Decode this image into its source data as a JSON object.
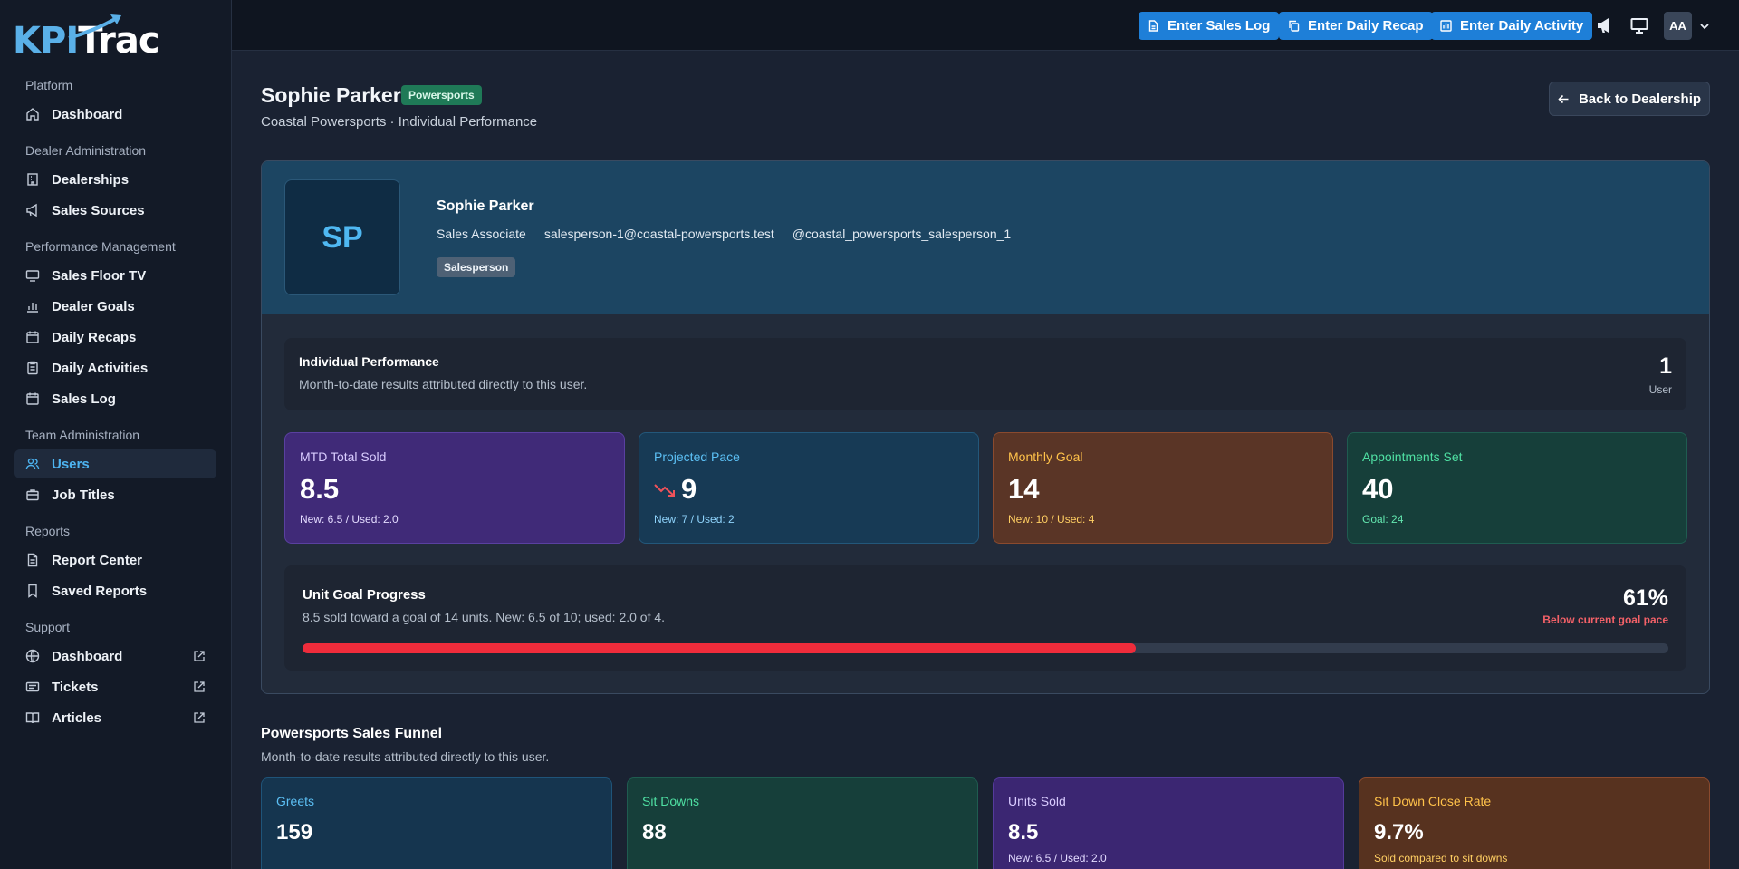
{
  "app": {
    "logo_text_a": "KPI",
    "logo_text_b": "Trac",
    "brand_color": "#1e7fd8"
  },
  "sidebar": {
    "sections": [
      {
        "title": "Platform",
        "items": [
          {
            "label": "Dashboard",
            "icon": "home-icon"
          }
        ]
      },
      {
        "title": "Dealer Administration",
        "items": [
          {
            "label": "Dealerships",
            "icon": "building-icon"
          },
          {
            "label": "Sales Sources",
            "icon": "megaphone-icon"
          }
        ]
      },
      {
        "title": "Performance Management",
        "items": [
          {
            "label": "Sales Floor TV",
            "icon": "monitor-icon"
          },
          {
            "label": "Dealer Goals",
            "icon": "bar-chart-icon"
          },
          {
            "label": "Daily Recaps",
            "icon": "calendar-icon"
          },
          {
            "label": "Daily Activities",
            "icon": "clipboard-icon"
          },
          {
            "label": "Sales Log",
            "icon": "calendar-icon"
          }
        ]
      },
      {
        "title": "Team Administration",
        "items": [
          {
            "label": "Users",
            "icon": "users-icon",
            "active": true
          },
          {
            "label": "Job Titles",
            "icon": "briefcase-icon"
          }
        ]
      },
      {
        "title": "Reports",
        "items": [
          {
            "label": "Report Center",
            "icon": "document-icon"
          },
          {
            "label": "Saved Reports",
            "icon": "bookmark-icon"
          }
        ]
      },
      {
        "title": "Support",
        "items": [
          {
            "label": "Dashboard",
            "icon": "globe-icon",
            "external": true
          },
          {
            "label": "Tickets",
            "icon": "ticket-icon",
            "external": true
          },
          {
            "label": "Articles",
            "icon": "book-icon",
            "external": true
          }
        ]
      }
    ]
  },
  "topbar": {
    "enter_sales_log": "Enter Sales Log",
    "enter_daily_recap": "Enter Daily Recap",
    "enter_daily_activity": "Enter Daily Activity",
    "avatar_initials": "AA"
  },
  "header": {
    "title": "Sophie Parker",
    "badge": "Powersports",
    "subtitle": "Coastal Powersports · Individual Performance",
    "back_button": "Back to Dealership"
  },
  "profile": {
    "initials": "SP",
    "name": "Sophie Parker",
    "job_title": "Sales Associate",
    "email": "salesperson-1@coastal-powersports.test",
    "username": "@coastal_powersports_salesperson_1",
    "role": "Salesperson"
  },
  "performance": {
    "title": "Individual Performance",
    "subtitle": "Month-to-date results attributed directly to this user.",
    "count": "1",
    "count_label": "User"
  },
  "stats": [
    {
      "label": "MTD Total Sold",
      "value": "8.5",
      "sub": "New: 6.5 / Used: 2.0",
      "theme": "purple"
    },
    {
      "label": "Projected Pace",
      "value": "9",
      "sub": "New: 7 / Used: 2",
      "theme": "blue",
      "trend": "down"
    },
    {
      "label": "Monthly Goal",
      "value": "14",
      "sub": "New: 10 / Used: 4",
      "theme": "orange"
    },
    {
      "label": "Appointments Set",
      "value": "40",
      "sub": "Goal: 24",
      "theme": "green"
    }
  ],
  "goal_progress": {
    "title": "Unit Goal Progress",
    "subtitle": "8.5 sold toward a goal of 14 units. New: 6.5 of 10; used: 2.0 of 4.",
    "percent_label": "61%",
    "percent": 61,
    "status": "Below current goal pace",
    "bar_color": "#ef2c3b"
  },
  "funnel": {
    "title": "Powersports Sales Funnel",
    "subtitle": "Month-to-date results attributed directly to this user.",
    "cards": [
      {
        "label": "Greets",
        "value": "159",
        "sub": "",
        "theme": "blue"
      },
      {
        "label": "Sit Downs",
        "value": "88",
        "sub": "",
        "theme": "green"
      },
      {
        "label": "Units Sold",
        "value": "8.5",
        "sub": "New: 6.5 / Used: 2.0",
        "theme": "purple"
      },
      {
        "label": "Sit Down Close Rate",
        "value": "9.7%",
        "sub": "Sold compared to sit downs",
        "theme": "orange"
      }
    ]
  }
}
